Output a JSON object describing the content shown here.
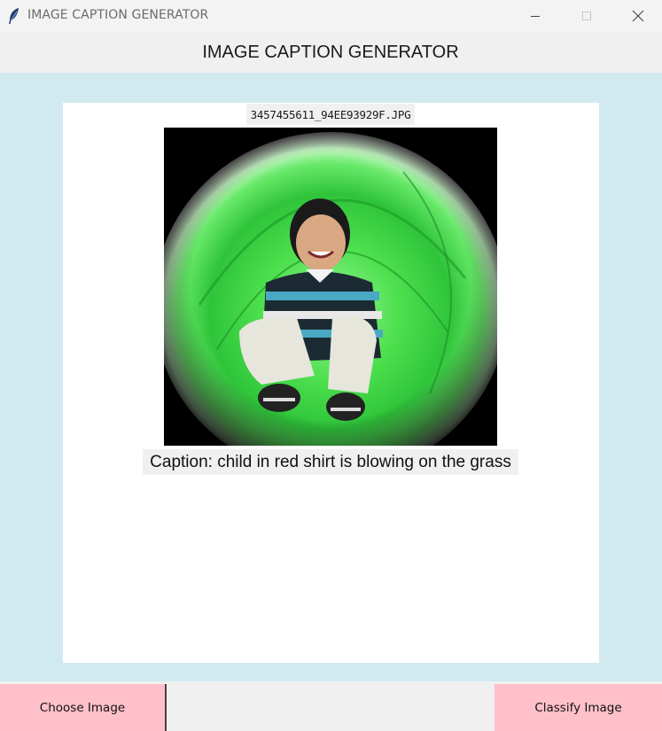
{
  "window": {
    "title": "IMAGE CAPTION GENERATOR",
    "icon": "feather-icon"
  },
  "header": {
    "title": "IMAGE CAPTION GENERATOR"
  },
  "image": {
    "filename": "3457455611_94EE93929F.JPG",
    "description_icon": "photo-child-in-green-tube"
  },
  "caption": {
    "text": "Caption: child in red shirt is blowing on the grass"
  },
  "buttons": {
    "choose_label": "Choose Image",
    "classify_label": "Classify Image"
  },
  "colors": {
    "background": "#d1eaf0",
    "button": "#ffc0cb",
    "panel": "#ffffff"
  }
}
